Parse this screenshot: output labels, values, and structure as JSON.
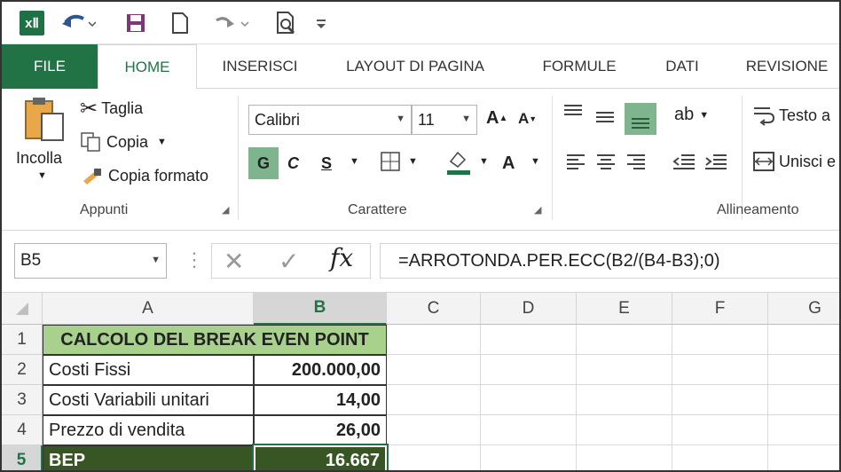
{
  "app": {
    "logo_text": "xⅡ"
  },
  "quick_access": [
    "undo-icon",
    "save-icon",
    "new-icon",
    "redo-icon",
    "print-preview-icon"
  ],
  "tabs": [
    "FILE",
    "HOME",
    "INSERISCI",
    "LAYOUT DI PAGINA",
    "FORMULE",
    "DATI",
    "REVISIONE"
  ],
  "ribbon": {
    "clipboard": {
      "paste": "Incolla",
      "cut": "Taglia",
      "copy": "Copia",
      "format_painter": "Copia formato",
      "label": "Appunti"
    },
    "font": {
      "name": "Calibri",
      "size": "11",
      "bold": "G",
      "italic": "C",
      "underline": "S",
      "font_color_letter": "A",
      "label": "Carattere"
    },
    "alignment": {
      "wrap_text": "Testo a",
      "merge": "Unisci e",
      "label": "Allineamento"
    }
  },
  "formula_bar": {
    "name_box": "B5",
    "fx": "fx",
    "formula": "=ARROTONDA.PER.ECC(B2/(B4-B3);0)"
  },
  "columns": [
    "A",
    "B",
    "C",
    "D",
    "E",
    "F",
    "G"
  ],
  "rows": [
    "1",
    "2",
    "3",
    "4",
    "5"
  ],
  "sheet": {
    "title": "CALCOLO DEL BREAK EVEN POINT",
    "data": [
      {
        "label": "Costi Fissi",
        "value": "200.000,00"
      },
      {
        "label": "Costi Variabili unitari",
        "value": "14,00"
      },
      {
        "label": "Prezzo di vendita",
        "value": "26,00"
      },
      {
        "label": "BEP",
        "value": "16.667"
      }
    ]
  },
  "colors": {
    "excel_green": "#217346",
    "title_fill": "#a9d18e",
    "result_fill": "#375623",
    "selection_fill": "#d6d6d6"
  }
}
